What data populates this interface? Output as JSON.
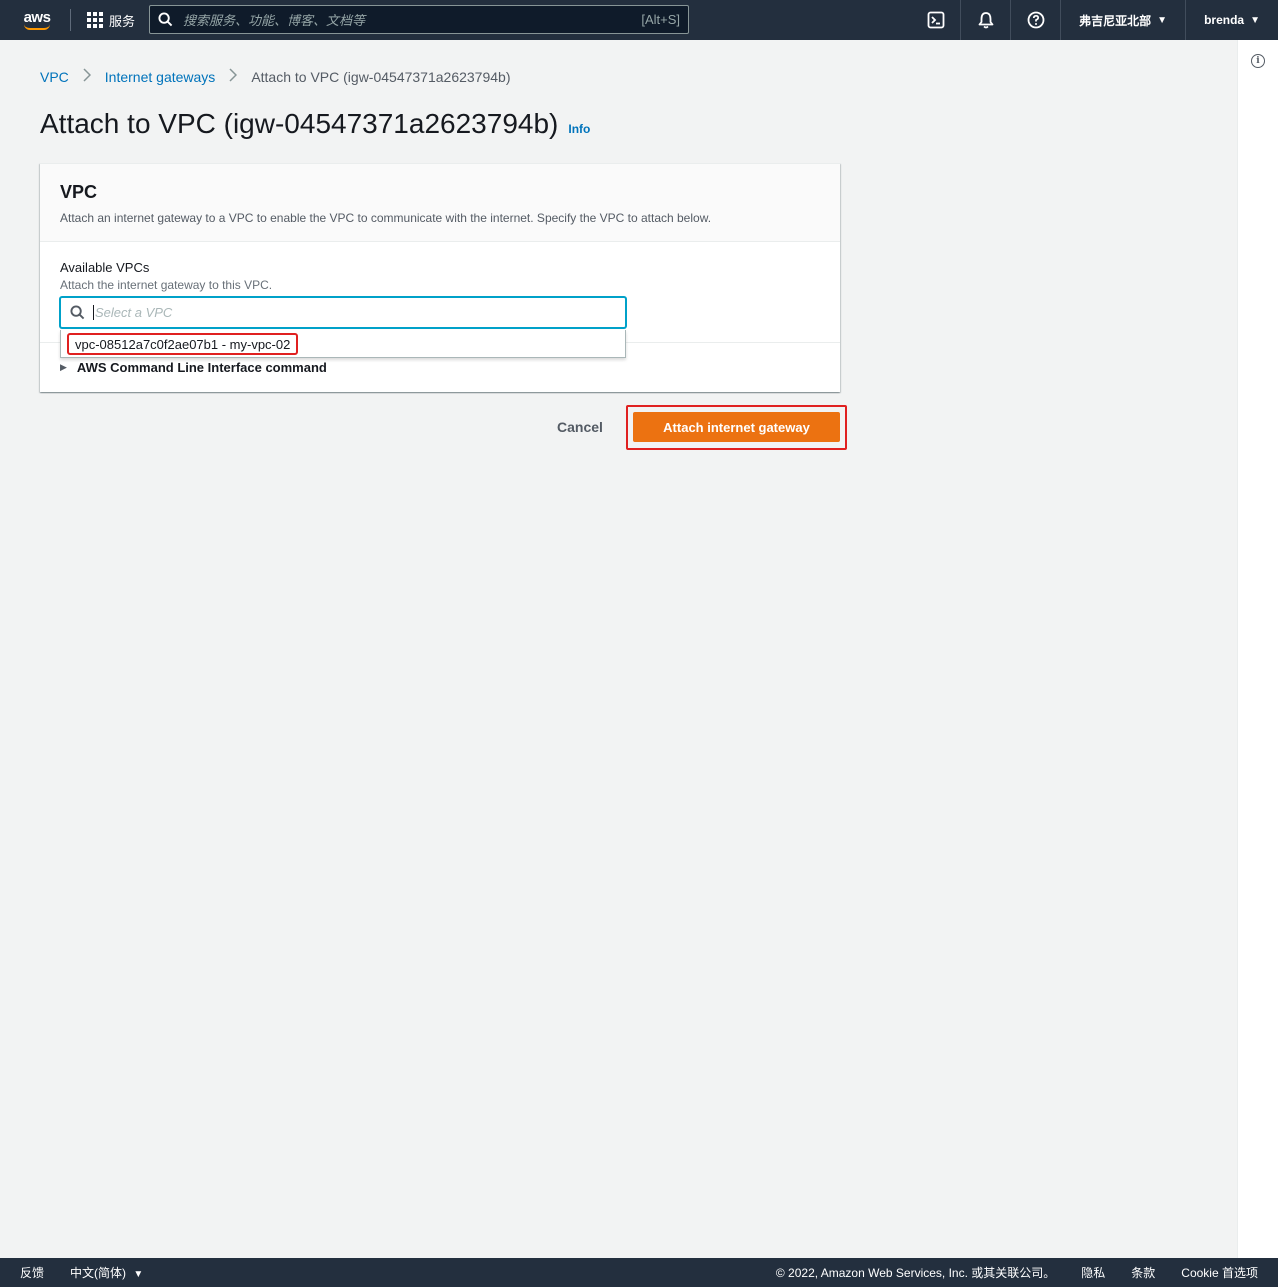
{
  "topnav": {
    "logo": "aws",
    "services_label": "服务",
    "search_placeholder": "搜索服务、功能、博客、文档等",
    "search_shortcut": "[Alt+S]",
    "region": "弗吉尼亚北部",
    "user": "brenda",
    "icons": [
      "cloudshell-icon",
      "bell-icon",
      "help-icon"
    ]
  },
  "breadcrumb": {
    "items": [
      "VPC",
      "Internet gateways"
    ],
    "current": "Attach to VPC (igw-04547371a2623794b)"
  },
  "page": {
    "title": "Attach to VPC (igw-04547371a2623794b)",
    "info_link": "Info"
  },
  "panel": {
    "heading": "VPC",
    "description": "Attach an internet gateway to a VPC to enable the VPC to communicate with the internet. Specify the VPC to attach below.",
    "field_label": "Available VPCs",
    "field_description": "Attach the internet gateway to this VPC.",
    "select_placeholder": "Select a VPC",
    "options": [
      "vpc-08512a7c0f2ae07b1 - my-vpc-02"
    ],
    "cli_label": "AWS Command Line Interface command"
  },
  "actions": {
    "cancel": "Cancel",
    "submit": "Attach internet gateway"
  },
  "footer": {
    "feedback": "反馈",
    "language": "中文(简体)",
    "copyright": "© 2022, Amazon Web Services, Inc. 或其关联公司。",
    "privacy": "隐私",
    "terms": "条款",
    "cookies": "Cookie 首选项"
  },
  "colors": {
    "nav_bg": "#232f3e",
    "primary_button": "#ec7211",
    "link": "#0073bb",
    "highlight": "#e02020",
    "focus": "#00a1c9"
  }
}
